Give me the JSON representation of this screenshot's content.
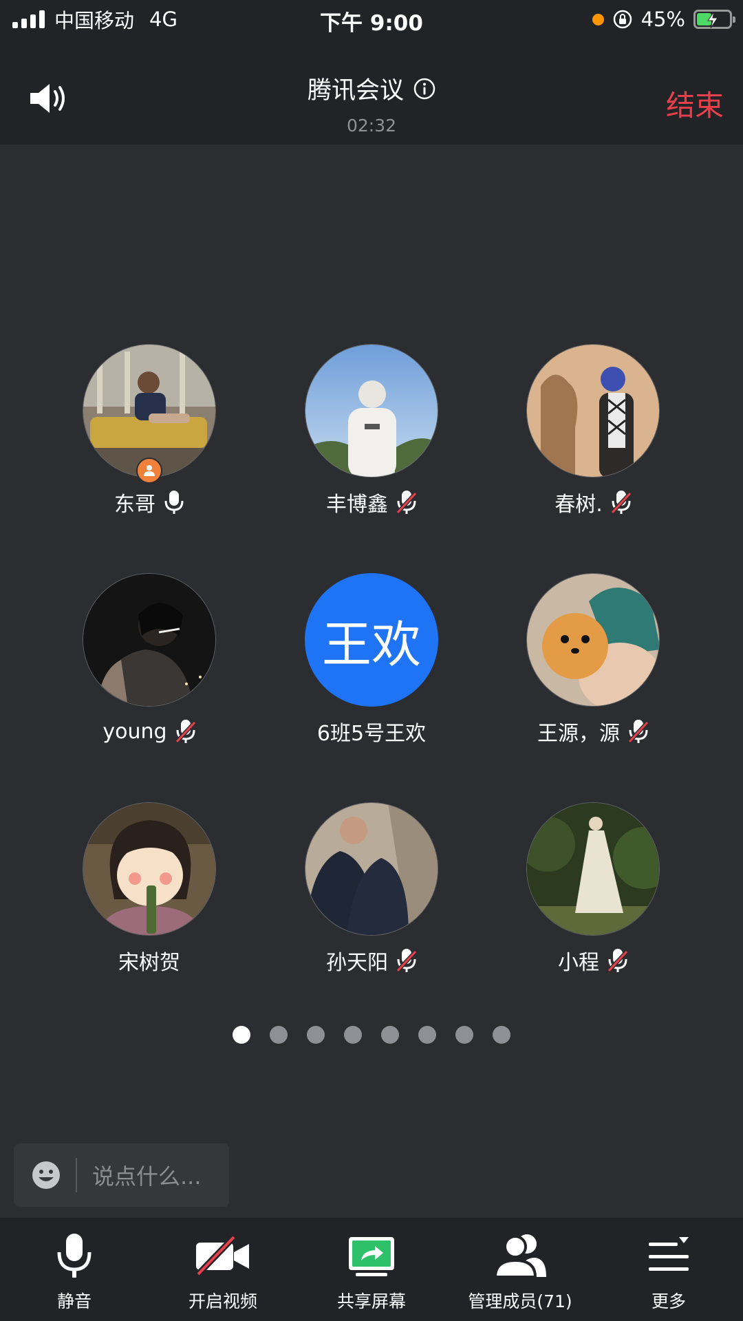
{
  "status_bar": {
    "carrier": "中国移动",
    "network": "4G",
    "time": "下午 9:00",
    "battery": "45%",
    "battery_level": 0.45
  },
  "header": {
    "title": "腾讯会议",
    "duration": "02:32",
    "end_label": "结束"
  },
  "participants": [
    {
      "name": "东哥",
      "mic": "on",
      "host": true
    },
    {
      "name": "丰博鑫",
      "mic": "muted"
    },
    {
      "name": "春树.",
      "mic": "muted"
    },
    {
      "name": "young",
      "mic": "muted"
    },
    {
      "name": "6班5号王欢",
      "mic": "none",
      "initials": "王欢"
    },
    {
      "name": "王源，源",
      "mic": "muted"
    },
    {
      "name": "宋树贺",
      "mic": "none"
    },
    {
      "name": "孙天阳",
      "mic": "muted"
    },
    {
      "name": "小程",
      "mic": "muted"
    }
  ],
  "pager": {
    "pages": 8,
    "current": 1
  },
  "chat": {
    "placeholder": "说点什么..."
  },
  "toolbar": {
    "mute_label": "静音",
    "video_label": "开启视频",
    "share_label": "共享屏幕",
    "members_label": "管理成员(71)",
    "more_label": "更多"
  },
  "colors": {
    "background": "#2b2d31",
    "bar": "#222326",
    "end": "#e8404a",
    "accent_blue": "#1e74f5",
    "share_green": "#2fc06a",
    "host_badge": "#f0813a"
  }
}
